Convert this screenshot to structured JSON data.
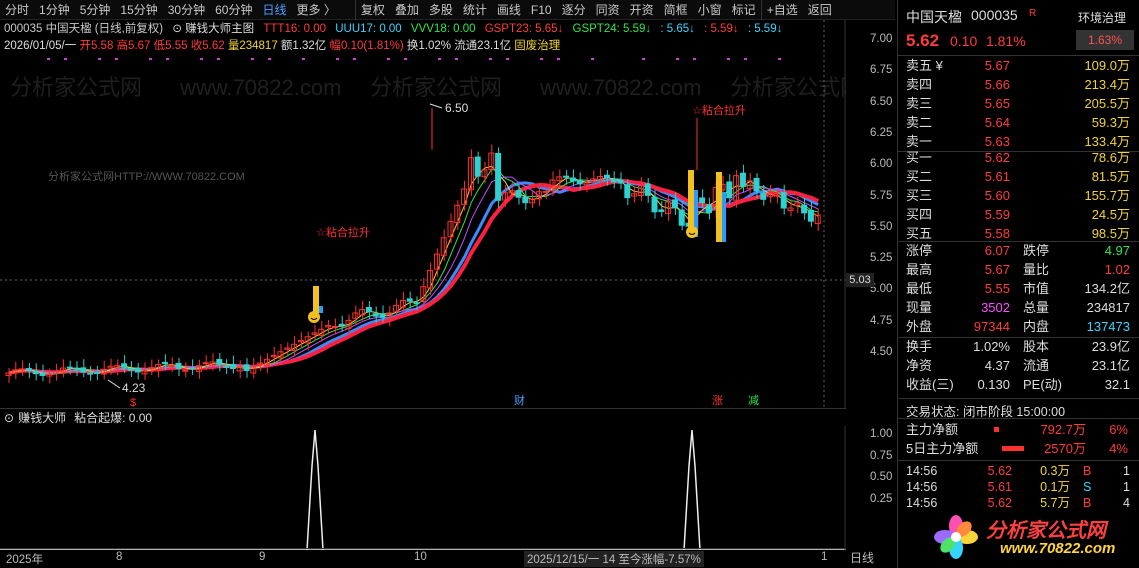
{
  "toolbar": {
    "items": [
      "分时",
      "1分钟",
      "5分钟",
      "15分钟",
      "30分钟",
      "60分钟",
      "日线",
      "更多 〉",
      "复权",
      "叠加",
      "多股",
      "统计",
      "画线",
      "F10",
      "逐分",
      "同资",
      "开资",
      "简框",
      "小窗",
      "标记",
      "+自选",
      "返回"
    ],
    "selected": "日线"
  },
  "chart_header": {
    "code_name": "000035 中国天楹 (日线,前复权)",
    "indicator_name": "赚钱大师主图",
    "ttt16": "TTT16: 0.00",
    "uuu17": "UUU17: 0.00",
    "vvv18": "VVV18: 0.00",
    "gspt23": "GSPT23: 5.65↓",
    "gspt24": "GSPT24: 5.59↓",
    "v3": ": 5.65↓",
    "v4": ": 5.59↓",
    "v5": ": 5.59↓"
  },
  "quote_line": {
    "date": "2026/01/05/一",
    "open": "开5.58",
    "high": "高5.67",
    "low": "低5.55",
    "close": "收5.62",
    "vol": "量234817",
    "amount": "额1.32亿",
    "amp": "幅0.10(1.81%)",
    "turn": "换1.02%",
    "float": "流通23.1亿",
    "concept": "固废治理"
  },
  "watermark": "分析家公式网HTTP://WWW.70822.COM",
  "annotations": {
    "high_label": "6.50",
    "low_label": "4.23",
    "signal1": "☆粘合拉升",
    "signal2": "☆粘合拉升",
    "current_price_tag": "5.03",
    "marker_cai": "财",
    "marker_zhang": "涨",
    "marker_jian": "减",
    "marker_s": "$"
  },
  "y_axis": [
    "7.00",
    "6.75",
    "6.50",
    "6.25",
    "6.00",
    "5.75",
    "5.50",
    "5.25",
    "5.00",
    "4.75",
    "4.50"
  ],
  "sub_indicator": {
    "name": "赚钱大师",
    "label": "粘合起爆: 0.00",
    "y_axis": [
      "1.00",
      "0.75",
      "0.50",
      "0.25"
    ]
  },
  "x_axis": {
    "labels": [
      "2025年",
      "8",
      "9",
      "10",
      "1"
    ],
    "range_info": "2025/12/15/一 14 至今涨幅-7.57%",
    "period": "日线"
  },
  "right_panel": {
    "name": "中国天楹",
    "code": "000035",
    "tag": "R",
    "sector": "环境治理",
    "sector_change": "1.63%",
    "price": "5.62",
    "change": "0.10",
    "change_pct": "1.81%",
    "asks": [
      {
        "label": "卖五 ¥",
        "price": "5.67",
        "vol": "109.0万"
      },
      {
        "label": "卖四",
        "price": "5.66",
        "vol": "213.4万"
      },
      {
        "label": "卖三",
        "price": "5.65",
        "vol": "205.5万"
      },
      {
        "label": "卖二",
        "price": "5.64",
        "vol": "59.3万"
      },
      {
        "label": "卖一",
        "price": "5.63",
        "vol": "133.4万"
      }
    ],
    "bids": [
      {
        "label": "买一",
        "price": "5.62",
        "vol": "78.6万"
      },
      {
        "label": "买二",
        "price": "5.61",
        "vol": "81.5万"
      },
      {
        "label": "买三",
        "price": "5.60",
        "vol": "155.7万"
      },
      {
        "label": "买四",
        "price": "5.59",
        "vol": "24.5万"
      },
      {
        "label": "买五",
        "price": "5.58",
        "vol": "98.5万"
      }
    ],
    "stats1": [
      {
        "k1": "涨停",
        "v1": "6.07",
        "k2": "跌停",
        "v2": "4.97"
      },
      {
        "k1": "最高",
        "v1": "5.67",
        "k2": "量比",
        "v2": "1.02"
      },
      {
        "k1": "最低",
        "v1": "5.55",
        "k2": "市值",
        "v2": "134.2亿"
      },
      {
        "k1": "现量",
        "v1": "3502",
        "k2": "总量",
        "v2": "234817"
      },
      {
        "k1": "外盘",
        "v1": "97344",
        "k2": "内盘",
        "v2": "137473"
      }
    ],
    "stats2": [
      {
        "k1": "换手",
        "v1": "1.02%",
        "k2": "股本",
        "v2": "23.9亿"
      },
      {
        "k1": "净资",
        "v1": "4.37",
        "k2": "流通",
        "v2": "23.1亿"
      },
      {
        "k1": "收益(三)",
        "v1": "0.130",
        "k2": "PE(动)",
        "v2": "32.1"
      }
    ],
    "trade_status": "交易状态: 闭市阶段 15:00:00",
    "flows": [
      {
        "label": "主力净额",
        "value": "792.7万",
        "pct": "6%"
      },
      {
        "label": "5日主力净额",
        "value": "2570万",
        "pct": "4%"
      }
    ],
    "ticks": [
      {
        "time": "14:56",
        "price": "5.62",
        "vol": "0.3万",
        "side": "B",
        "n": "1"
      },
      {
        "time": "14:56",
        "price": "5.61",
        "vol": "0.1万",
        "side": "S",
        "n": "1"
      },
      {
        "time": "14:56",
        "price": "5.62",
        "vol": "5.7万",
        "side": "B",
        "n": "4"
      }
    ],
    "logo_text": "分析家公式网",
    "logo_url": "www.70822.com"
  }
}
